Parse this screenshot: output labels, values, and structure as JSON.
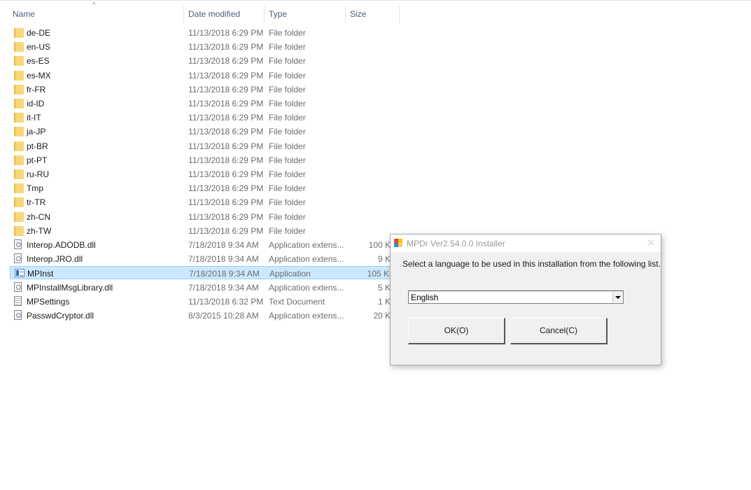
{
  "explorer": {
    "columns": {
      "name": "Name",
      "date": "Date modified",
      "type": "Type",
      "size": "Size",
      "sort_indicator": "^"
    },
    "files": [
      {
        "name": "de-DE",
        "date": "11/13/2018 6:29 PM",
        "type": "File folder",
        "size": "",
        "icon": "folder-icon"
      },
      {
        "name": "en-US",
        "date": "11/13/2018 6:29 PM",
        "type": "File folder",
        "size": "",
        "icon": "folder-icon"
      },
      {
        "name": "es-ES",
        "date": "11/13/2018 6:29 PM",
        "type": "File folder",
        "size": "",
        "icon": "folder-icon"
      },
      {
        "name": "es-MX",
        "date": "11/13/2018 6:29 PM",
        "type": "File folder",
        "size": "",
        "icon": "folder-icon"
      },
      {
        "name": "fr-FR",
        "date": "11/13/2018 6:29 PM",
        "type": "File folder",
        "size": "",
        "icon": "folder-icon"
      },
      {
        "name": "id-ID",
        "date": "11/13/2018 6:29 PM",
        "type": "File folder",
        "size": "",
        "icon": "folder-icon"
      },
      {
        "name": "it-IT",
        "date": "11/13/2018 6:29 PM",
        "type": "File folder",
        "size": "",
        "icon": "folder-icon"
      },
      {
        "name": "ja-JP",
        "date": "11/13/2018 6:29 PM",
        "type": "File folder",
        "size": "",
        "icon": "folder-icon"
      },
      {
        "name": "pt-BR",
        "date": "11/13/2018 6:29 PM",
        "type": "File folder",
        "size": "",
        "icon": "folder-icon"
      },
      {
        "name": "pt-PT",
        "date": "11/13/2018 6:29 PM",
        "type": "File folder",
        "size": "",
        "icon": "folder-icon"
      },
      {
        "name": "ru-RU",
        "date": "11/13/2018 6:29 PM",
        "type": "File folder",
        "size": "",
        "icon": "folder-icon"
      },
      {
        "name": "Tmp",
        "date": "11/13/2018 6:29 PM",
        "type": "File folder",
        "size": "",
        "icon": "folder-icon"
      },
      {
        "name": "tr-TR",
        "date": "11/13/2018 6:29 PM",
        "type": "File folder",
        "size": "",
        "icon": "folder-icon"
      },
      {
        "name": "zh-CN",
        "date": "11/13/2018 6:29 PM",
        "type": "File folder",
        "size": "",
        "icon": "folder-icon"
      },
      {
        "name": "zh-TW",
        "date": "11/13/2018 6:29 PM",
        "type": "File folder",
        "size": "",
        "icon": "folder-icon"
      },
      {
        "name": "Interop.ADODB.dll",
        "date": "7/18/2018 9:34 AM",
        "type": "Application extens...",
        "size": "100 K",
        "icon": "dll-icon"
      },
      {
        "name": "Interop.JRO.dll",
        "date": "7/18/2018 9:34 AM",
        "type": "Application extens...",
        "size": "9 K",
        "icon": "dll-icon"
      },
      {
        "name": "MPInst",
        "date": "7/18/2018 9:34 AM",
        "type": "Application",
        "size": "105 K",
        "icon": "application-icon",
        "selected": true
      },
      {
        "name": "MPInstallMsgLibrary.dll",
        "date": "7/18/2018 9:34 AM",
        "type": "Application extens...",
        "size": "5 K",
        "icon": "dll-icon"
      },
      {
        "name": "MPSettings",
        "date": "11/13/2018 6:32 PM",
        "type": "Text Document",
        "size": "1 K",
        "icon": "text-document-icon"
      },
      {
        "name": "PasswdCryptor.dll",
        "date": "8/3/2015 10:28 AM",
        "type": "Application extens...",
        "size": "20 K",
        "icon": "dll-icon"
      }
    ]
  },
  "dialog": {
    "title": "MPDr Ver2.54.0.0 Installer",
    "close_glyph": "✕",
    "prompt": "Select a language to be used in this installation from the following list.",
    "language_select": {
      "value": "English"
    },
    "ok_label": "OK(O)",
    "cancel_label": "Cancel(C)"
  }
}
